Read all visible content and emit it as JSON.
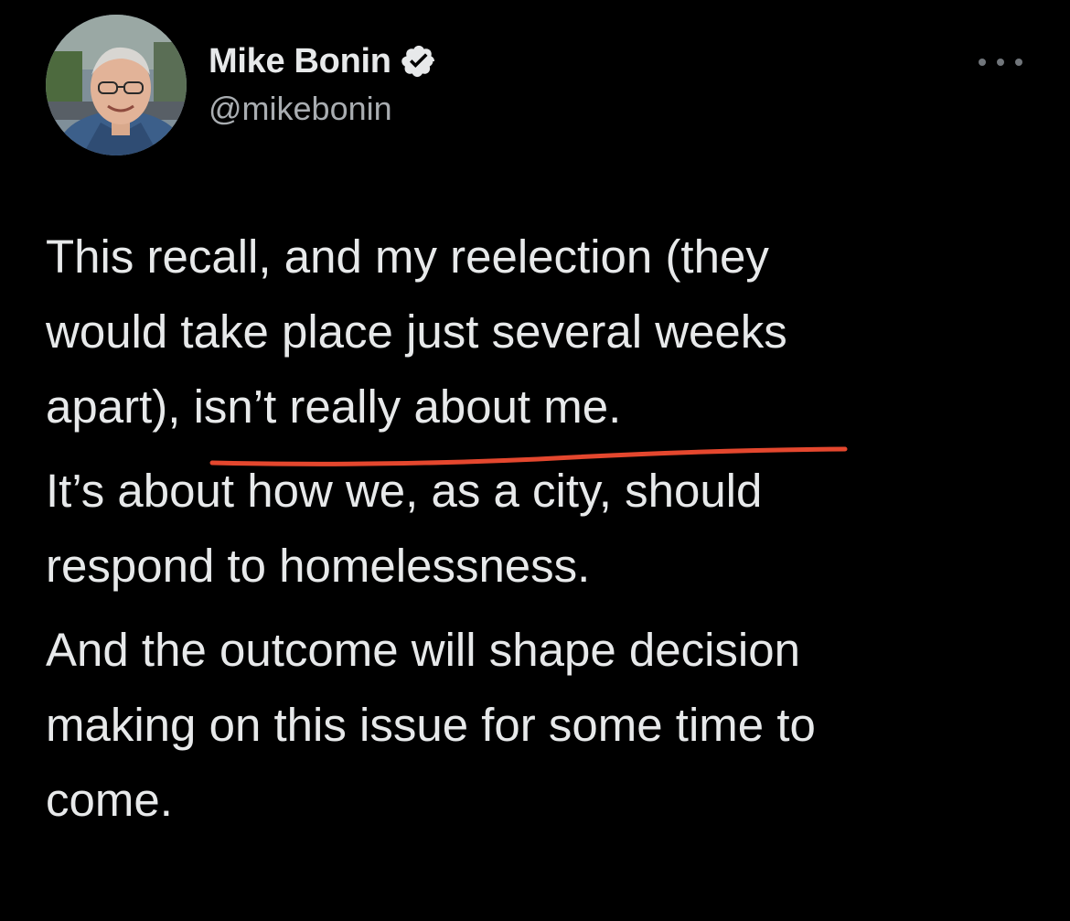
{
  "author": {
    "display_name": "Mike Bonin",
    "handle": "@mikebonin",
    "verified": true,
    "avatar_icon": "profile-photo"
  },
  "menu": {
    "icon": "more-dots-icon"
  },
  "tweet": {
    "paragraph_1": "This recall, and my reelection (they\nwould take place just several weeks\napart), isn’t really about me.",
    "paragraph_2": "It’s about how we, as a city, should\nrespond to homelessness.",
    "paragraph_3": "And the outcome will shape decision\nmaking on this issue for some time to\ncome."
  },
  "annotation": {
    "underline_color": "#e4472e"
  },
  "colors": {
    "background": "#000000",
    "text_primary": "#e7e9ea",
    "text_secondary": "#a9adb1"
  }
}
